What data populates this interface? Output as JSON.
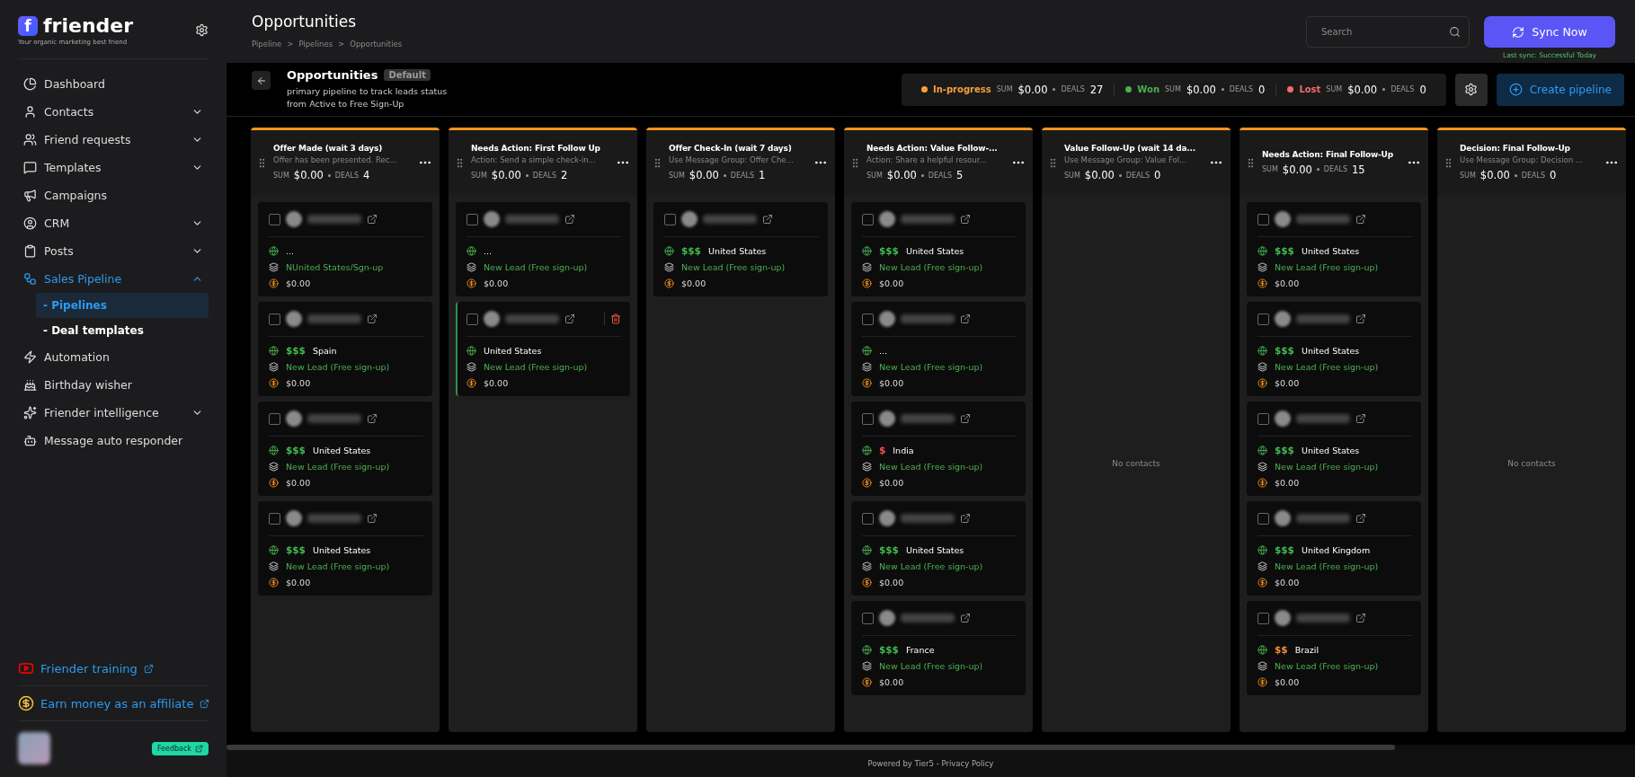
{
  "sidebar": {
    "logo_mark": "f",
    "brand": "friender",
    "tagline": "Your organic marketing best friend",
    "items": [
      {
        "label": "Dashboard",
        "expandable": false,
        "selected": false
      },
      {
        "label": "Contacts",
        "expandable": true,
        "expanded": false,
        "selected": false
      },
      {
        "label": "Friend requests",
        "expandable": true,
        "expanded": false,
        "selected": false
      },
      {
        "label": "Templates",
        "expandable": true,
        "expanded": false,
        "selected": false
      },
      {
        "label": "Campaigns",
        "expandable": false,
        "selected": false
      },
      {
        "label": "CRM",
        "expandable": true,
        "expanded": false,
        "selected": false
      },
      {
        "label": "Posts",
        "expandable": true,
        "expanded": false,
        "selected": false
      },
      {
        "label": "Sales Pipeline",
        "expandable": true,
        "expanded": true,
        "selected": true,
        "children": [
          {
            "label": "- Pipelines",
            "selected": true
          },
          {
            "label": "- Deal templates",
            "selected": false
          }
        ]
      },
      {
        "label": "Automation",
        "expandable": false,
        "selected": false
      },
      {
        "label": "Birthday wisher",
        "expandable": false,
        "selected": false
      },
      {
        "label": "Friender intelligence",
        "expandable": true,
        "expanded": false,
        "selected": false
      },
      {
        "label": "Message auto responder",
        "expandable": false,
        "selected": false
      }
    ],
    "training_link": "Friender training",
    "affiliate_link": "Earn money as an affiliate",
    "feedback_button": "Feedback"
  },
  "header": {
    "title": "Opportunities",
    "breadcrumb": [
      "Pipeline",
      "Pipelines",
      "Opportunities"
    ],
    "separator": ">",
    "search": {
      "placeholder": "Search"
    },
    "sync_button": "Sync Now",
    "last_sync": "Last sync: Successful Today"
  },
  "pipeline": {
    "title": "Opportunities",
    "badge": "Default",
    "description": "primary pipeline to track leads status from Active to Free Sign-Up",
    "stats": [
      {
        "label": "In-progress",
        "color": "#f5a03a",
        "sum_label": "SUM",
        "sum": "$0.00",
        "deals_label": "DEALS",
        "deals": "27"
      },
      {
        "label": "Won",
        "color": "#4caf50",
        "sum_label": "SUM",
        "sum": "$0.00",
        "deals_label": "DEALS",
        "deals": "0"
      },
      {
        "label": "Lost",
        "color": "#f26d6d",
        "sum_label": "SUM",
        "sum": "$0.00",
        "deals_label": "DEALS",
        "deals": "0"
      }
    ],
    "create_button": "Create pipeline"
  },
  "columns": [
    {
      "title": "Offer Made (wait 3 days)",
      "subtitle": "Offer has been presented. Rec...",
      "sum_label": "SUM",
      "sum": "$0.00",
      "deals_label": "DEALS",
      "deals": "4",
      "cards": [
        {
          "checked": false,
          "hovered": false,
          "country": "...",
          "status": "NUnited States/Sgn-up",
          "amount": "$0.00"
        },
        {
          "checked": false,
          "hovered": false,
          "price": {
            "text": "$$$",
            "color": "#3fb950"
          },
          "country": "Spain",
          "status": "New Lead (Free sign-up)",
          "amount": "$0.00"
        },
        {
          "checked": false,
          "hovered": false,
          "price": {
            "text": "$$$",
            "color": "#3fb950"
          },
          "country": "United States",
          "status": "New Lead (Free sign-up)",
          "amount": "$0.00"
        },
        {
          "checked": false,
          "hovered": false,
          "price": {
            "text": "$$$",
            "color": "#3fb950"
          },
          "country": "United States",
          "status": "New Lead (Free sign-up)",
          "amount": "$0.00"
        }
      ]
    },
    {
      "title": "Needs Action: First Follow Up",
      "subtitle": "Action: Send a simple check-in...",
      "sum_label": "SUM",
      "sum": "$0.00",
      "deals_label": "DEALS",
      "deals": "2",
      "cards": [
        {
          "checked": false,
          "hovered": false,
          "country": "...",
          "status": "New Lead (Free sign-up)",
          "amount": "$0.00"
        },
        {
          "checked": false,
          "hovered": true,
          "country": "United States",
          "status": "New Lead (Free sign-up)",
          "amount": "$0.00"
        }
      ]
    },
    {
      "title": "Offer Check-In (wait 7 days)",
      "subtitle": "Use Message Group: Offer Che...",
      "sum_label": "SUM",
      "sum": "$0.00",
      "deals_label": "DEALS",
      "deals": "1",
      "cards": [
        {
          "checked": false,
          "hovered": false,
          "price": {
            "text": "$$$",
            "color": "#3fb950"
          },
          "country": "United States",
          "status": "New Lead (Free sign-up)",
          "amount": "$0.00"
        }
      ]
    },
    {
      "title": "Needs Action: Value Follow-...",
      "subtitle": "Action: Share a helpful resour...",
      "sum_label": "SUM",
      "sum": "$0.00",
      "deals_label": "DEALS",
      "deals": "5",
      "cards": [
        {
          "checked": false,
          "hovered": false,
          "price": {
            "text": "$$$",
            "color": "#3fb950"
          },
          "country": "United States",
          "status": "New Lead (Free sign-up)",
          "amount": "$0.00"
        },
        {
          "checked": false,
          "hovered": false,
          "country": "...",
          "status": "New Lead (Free sign-up)",
          "amount": "$0.00"
        },
        {
          "checked": false,
          "hovered": false,
          "price": {
            "text": "$",
            "color": "#f0524f"
          },
          "country": "India",
          "status": "New Lead (Free sign-up)",
          "amount": "$0.00"
        },
        {
          "checked": false,
          "hovered": false,
          "price": {
            "text": "$$$",
            "color": "#3fb950"
          },
          "country": "United States",
          "status": "New Lead (Free sign-up)",
          "amount": "$0.00"
        },
        {
          "checked": false,
          "hovered": false,
          "price": {
            "text": "$$$",
            "color": "#3fb950"
          },
          "country": "France",
          "status": "New Lead (Free sign-up)",
          "amount": "$0.00"
        }
      ]
    },
    {
      "title": "Value Follow-Up (wait 14 da...",
      "subtitle": "Use Message Group: Value Fol...",
      "sum_label": "SUM",
      "sum": "$0.00",
      "deals_label": "DEALS",
      "deals": "0",
      "empty_text": "No contacts"
    },
    {
      "title": "Needs Action: Final Follow-Up",
      "sum_label": "SUM",
      "sum": "$0.00",
      "deals_label": "DEALS",
      "deals": "15",
      "cards": [
        {
          "checked": false,
          "hovered": false,
          "price": {
            "text": "$$$",
            "color": "#3fb950"
          },
          "country": "United States",
          "status": "New Lead (Free sign-up)",
          "amount": "$0.00"
        },
        {
          "checked": false,
          "hovered": false,
          "price": {
            "text": "$$$",
            "color": "#3fb950"
          },
          "country": "United States",
          "status": "New Lead (Free sign-up)",
          "amount": "$0.00"
        },
        {
          "checked": false,
          "hovered": false,
          "price": {
            "text": "$$$",
            "color": "#3fb950"
          },
          "country": "United States",
          "status": "New Lead (Free sign-up)",
          "amount": "$0.00"
        },
        {
          "checked": false,
          "hovered": false,
          "price": {
            "text": "$$$",
            "color": "#3fb950"
          },
          "country": "United Kingdom",
          "status": "New Lead (Free sign-up)",
          "amount": "$0.00"
        },
        {
          "checked": false,
          "hovered": false,
          "price": {
            "text": "$$",
            "color": "#f08a3a"
          },
          "country": "Brazil",
          "status": "New Lead (Free sign-up)",
          "amount": "$0.00"
        }
      ]
    },
    {
      "title": "Decision: Final Follow-Up",
      "subtitle": "Use Message Group: Decision ...",
      "sum_label": "SUM",
      "sum": "$0.00",
      "deals_label": "DEALS",
      "deals": "0",
      "empty_text": "No contacts"
    }
  ],
  "footer": "Powered by Tier5 - Privacy Policy"
}
